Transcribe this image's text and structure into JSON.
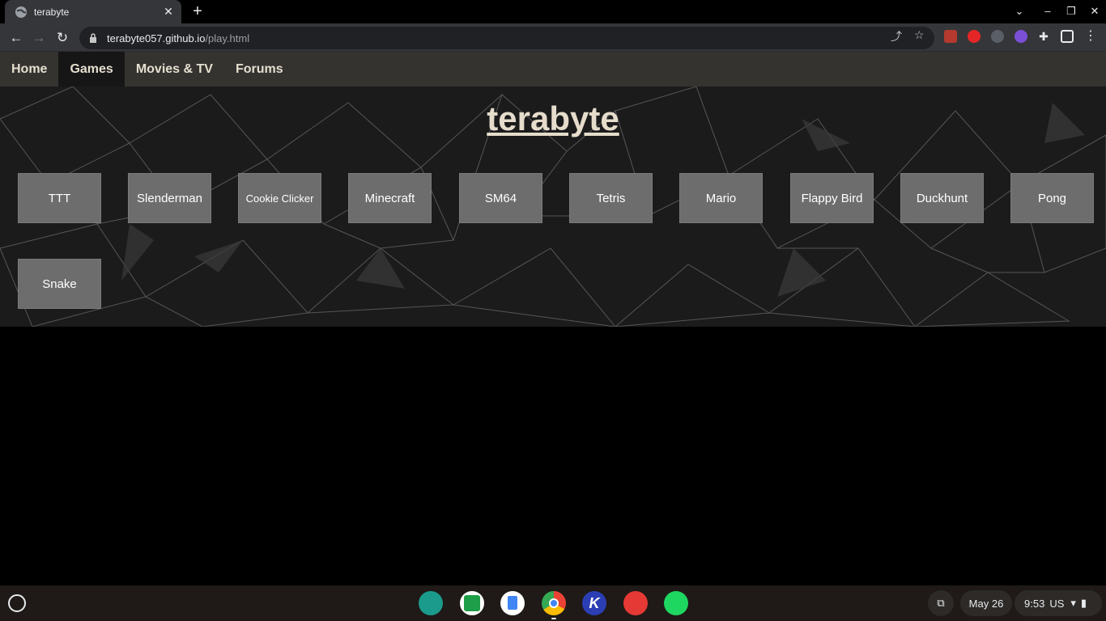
{
  "browser": {
    "tab_title": "terabyte",
    "url_host": "terabyte057.github.io",
    "url_path": "/play.html"
  },
  "site": {
    "nav": [
      {
        "label": "Home",
        "active": false
      },
      {
        "label": "Games",
        "active": true
      },
      {
        "label": "Movies & TV",
        "active": false
      },
      {
        "label": "Forums",
        "active": false
      }
    ],
    "brand": "terabyte",
    "games": [
      "TTT",
      "Slenderman",
      "Cookie Clicker",
      "Minecraft",
      "SM64",
      "Tetris",
      "Mario",
      "Flappy Bird",
      "Duckhunt",
      "Pong",
      "Snake"
    ]
  },
  "shelf": {
    "apps": [
      "classroom-icon",
      "jamboard-icon",
      "docs-icon",
      "chrome-icon",
      "kami-icon",
      "paint-icon",
      "spotify-icon"
    ],
    "date": "May 26",
    "time": "9:53",
    "locale": "US"
  },
  "colors": {
    "page_bg": "#000000",
    "nav_bg": "#353330",
    "nav_active": "#171617",
    "brand_text": "#e5dccb",
    "button_bg": "#6d6d6d"
  }
}
